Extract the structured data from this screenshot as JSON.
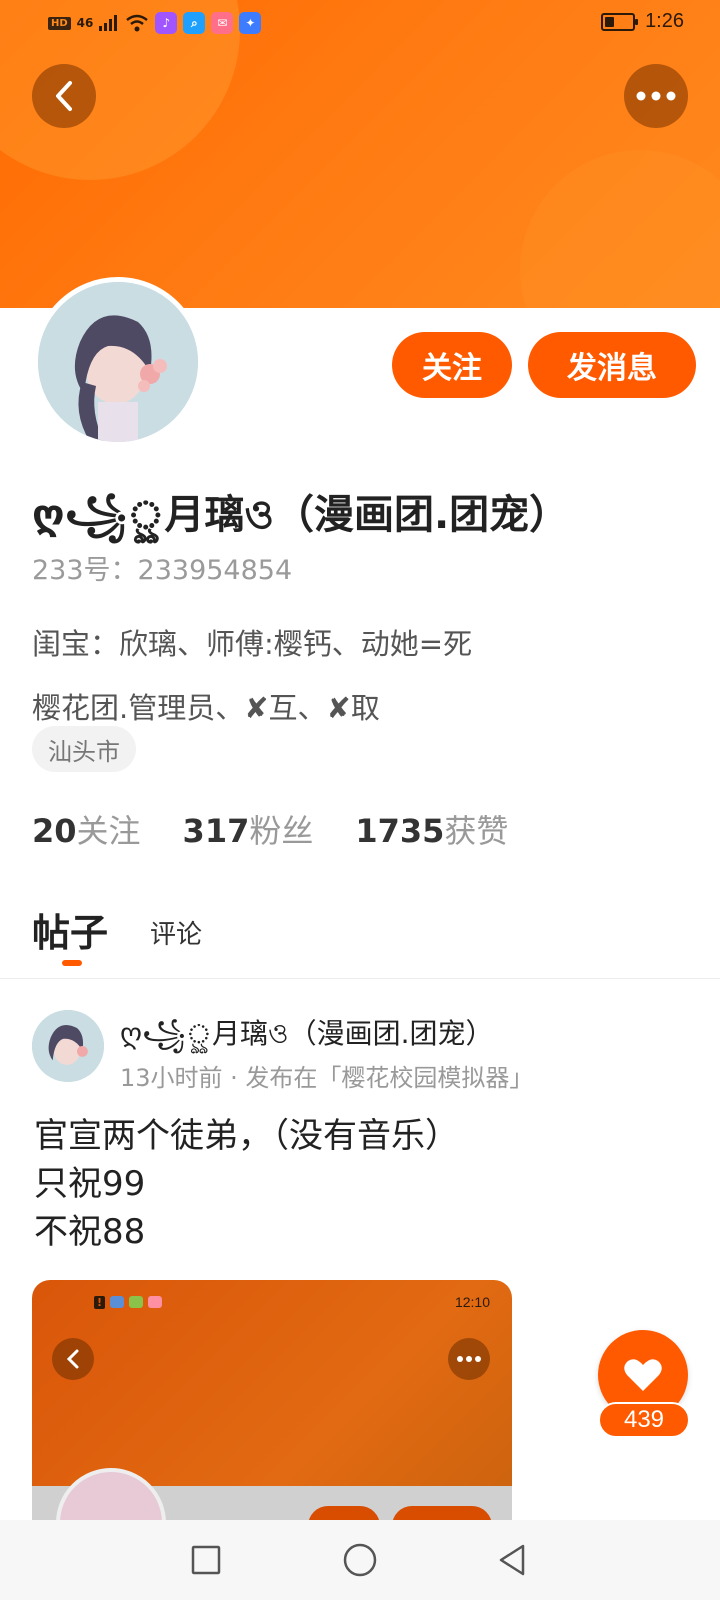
{
  "status_bar": {
    "network": "HD",
    "signal": "46",
    "time": "1:26",
    "battery_level": 0.35,
    "app_icons": [
      "music-icon",
      "search-app-icon",
      "mail-app-icon",
      "lightbulb-app-icon"
    ]
  },
  "header": {
    "back_icon": "chevron-left-icon",
    "more_icon": "more-dots-icon"
  },
  "profile": {
    "follow_label": "关注",
    "message_label": "发消息",
    "username": "ღ꧁ৣ月璃ও（漫画团.团宠）",
    "user_id": "233号：233954854",
    "bio_lines": [
      "闺宝：欣璃、师傅:樱钙、动她=死",
      "樱花团.管理员、✘互、✘取"
    ],
    "location": "汕头市",
    "stats": [
      {
        "num": "20",
        "label": "关注"
      },
      {
        "num": "317",
        "label": "粉丝"
      },
      {
        "num": "1735",
        "label": "获赞"
      }
    ]
  },
  "tabs": {
    "posts": "帖子",
    "comments": "评论"
  },
  "post": {
    "author": "ღ꧁ৣ月璃ও（漫画团.团宠）",
    "meta": "13小时前 · 发布在「樱花校园模拟器」",
    "text_lines": [
      "官宣两个徒弟，（没有音乐）",
      "只祝99",
      "不祝88"
    ],
    "image_time": "12:10",
    "like_count": "439"
  },
  "colors": {
    "accent": "#ff5a00",
    "banner": "#ff7a12"
  }
}
